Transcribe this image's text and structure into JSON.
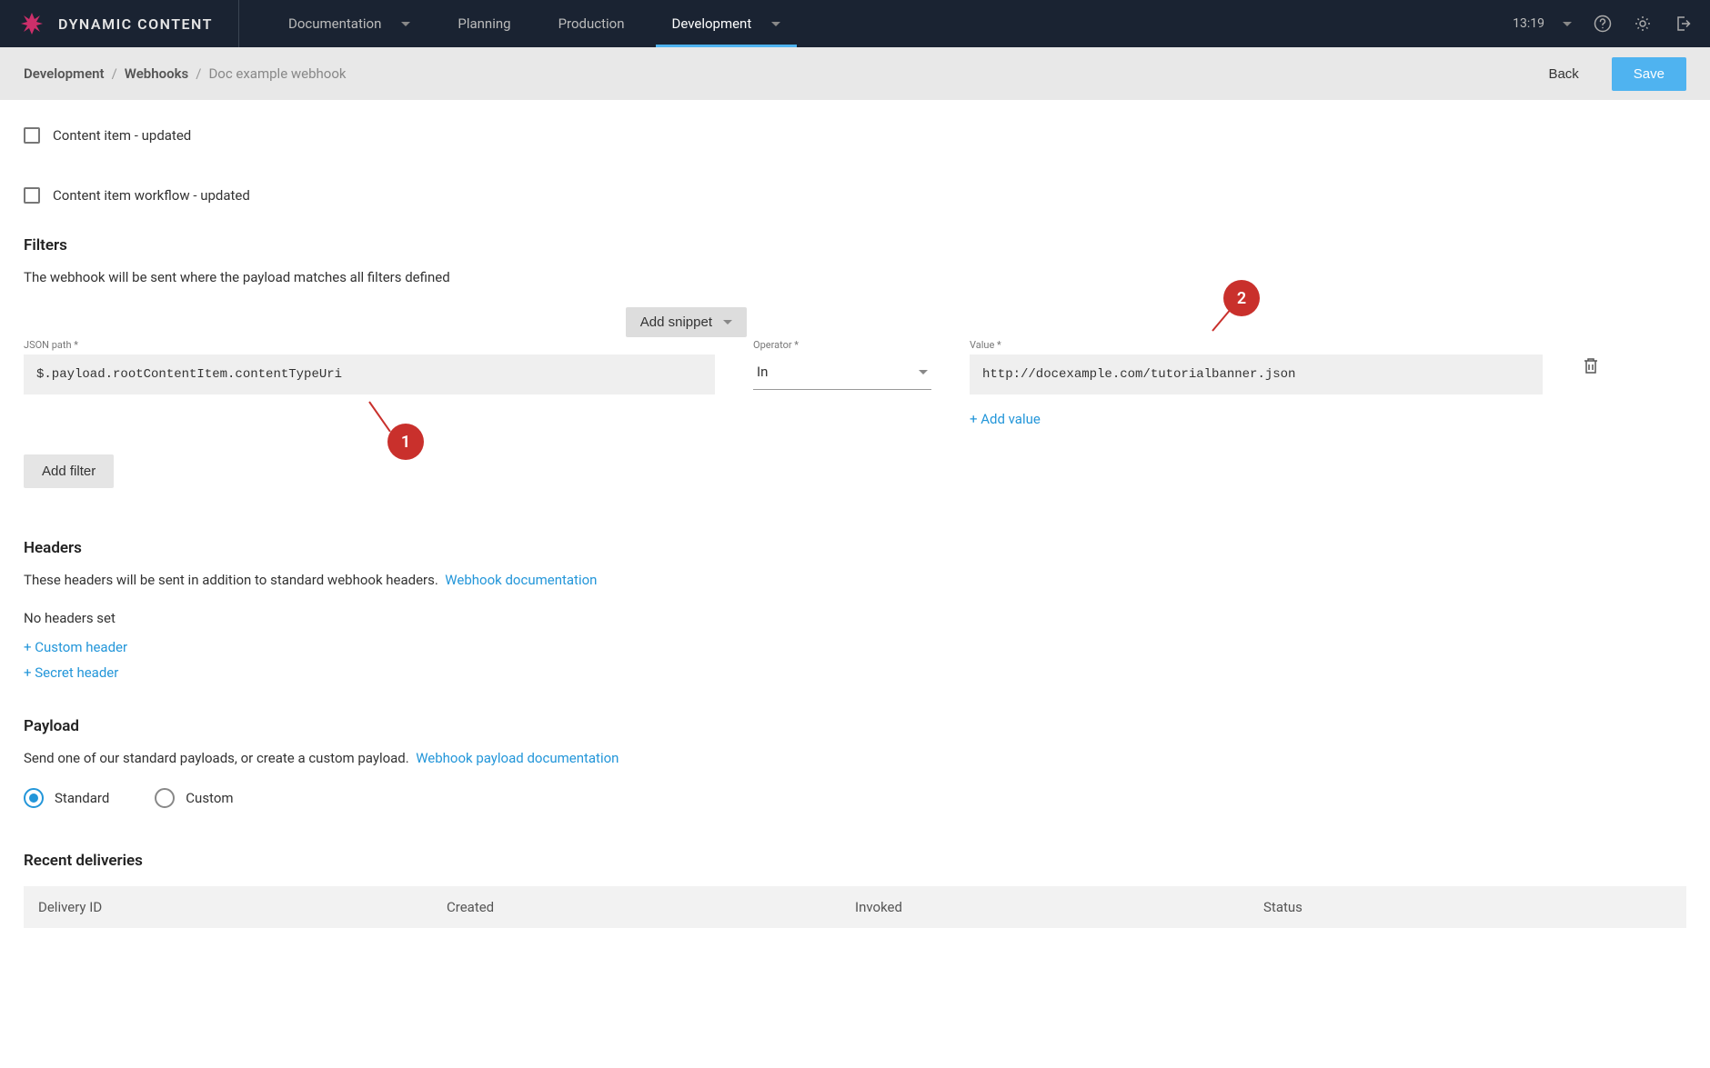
{
  "header": {
    "brand": "DYNAMIC CONTENT",
    "nav_items": [
      {
        "label": "Documentation",
        "has_dropdown": true,
        "active": false
      },
      {
        "label": "Planning",
        "has_dropdown": false,
        "active": false
      },
      {
        "label": "Production",
        "has_dropdown": false,
        "active": false
      },
      {
        "label": "Development",
        "has_dropdown": true,
        "active": true
      }
    ],
    "time": "13:19"
  },
  "subheader": {
    "crumbs": [
      "Development",
      "Webhooks",
      "Doc example webhook"
    ],
    "back_label": "Back",
    "save_label": "Save"
  },
  "checkboxes": {
    "item_updated": "Content item - updated",
    "workflow_updated": "Content item workflow - updated"
  },
  "filters": {
    "title": "Filters",
    "description": "The webhook will be sent where the payload matches all filters defined",
    "add_snippet_label": "Add snippet",
    "json_path_label": "JSON path *",
    "json_path_value": "$.payload.rootContentItem.contentTypeUri",
    "operator_label": "Operator *",
    "operator_value": "In",
    "value_label": "Value *",
    "value_value": "http://docexample.com/tutorialbanner.json",
    "add_value_label": "+ Add value",
    "add_filter_label": "Add filter"
  },
  "headers_section": {
    "title": "Headers",
    "description": "These headers will be sent in addition to standard webhook headers.",
    "doc_link": "Webhook documentation",
    "status": "No headers set",
    "custom_header_link": "+ Custom header",
    "secret_header_link": "+ Secret header"
  },
  "payload": {
    "title": "Payload",
    "description": "Send one of our standard payloads, or create a custom payload.",
    "doc_link": "Webhook payload documentation",
    "options": {
      "standard": "Standard",
      "custom": "Custom"
    }
  },
  "deliveries": {
    "title": "Recent deliveries",
    "columns": [
      "Delivery ID",
      "Created",
      "Invoked",
      "Status"
    ]
  },
  "annotations": {
    "marker1": "1",
    "marker2": "2"
  }
}
